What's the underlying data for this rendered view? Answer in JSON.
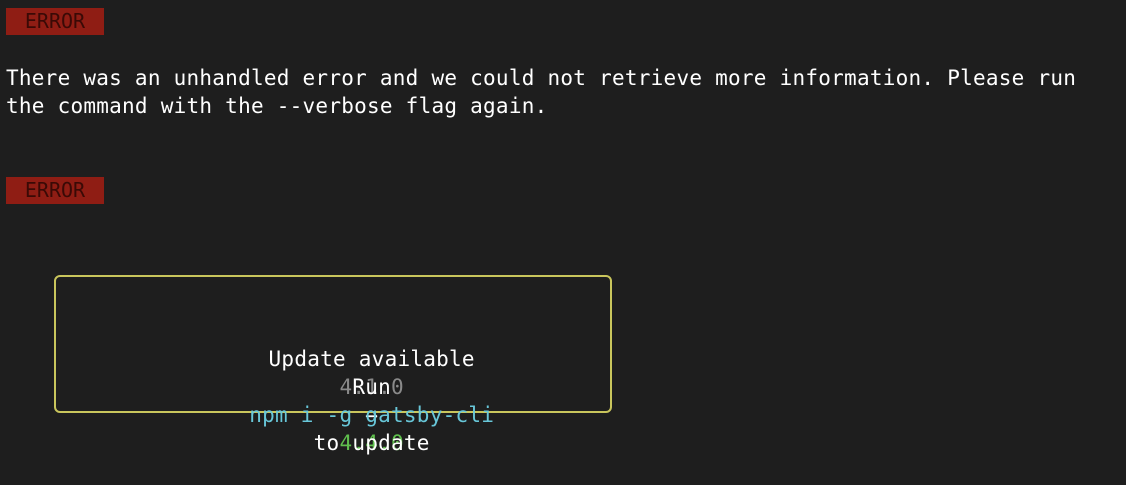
{
  "terminal": {
    "badges": {
      "first": "ERROR",
      "second": "ERROR"
    },
    "message": "There was an unhandled error and we could not retrieve more information. Please run the command with the --verbose flag again.",
    "update": {
      "label": "Update available",
      "current_version": "4.1.0",
      "arrow": "→",
      "new_version": "4.4.0",
      "run_label": "Run",
      "command": "npm i -g gatsby-cli",
      "suffix": "to update"
    }
  },
  "colors": {
    "background": "#1e1e1e",
    "error_badge": "#8f1d14",
    "box_border": "#c9c55c",
    "old_version": "#8a8a8a",
    "new_version": "#5fbf4d",
    "command": "#68c7d9"
  }
}
